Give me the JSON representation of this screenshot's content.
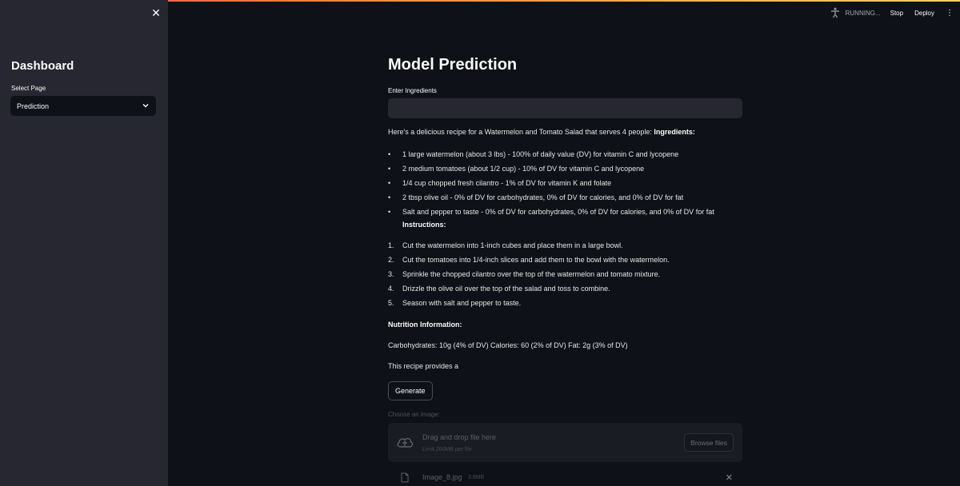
{
  "sidebar": {
    "close_icon": "close-icon",
    "title": "Dashboard",
    "select_label": "Select Page",
    "select_value": "Prediction"
  },
  "header": {
    "status": "RUNNING...",
    "stop": "Stop",
    "deploy": "Deploy",
    "menu": "⋮"
  },
  "main": {
    "title": "Model Prediction",
    "input_label": "Enter Ingredients",
    "input_value": "",
    "intro_text": "Here's a delicious recipe for a Watermelon and Tomato Salad that serves 4 people: ",
    "ingredients_heading": "Ingredients:",
    "ingredients": [
      "1 large watermelon (about 3 lbs) - 100% of daily value (DV) for vitamin C and lycopene",
      "2 medium tomatoes (about 1/2 cup) - 10% of DV for vitamin C and lycopene",
      "1/4 cup chopped fresh cilantro - 1% of DV for vitamin K and folate",
      "2 tbsp olive oil - 0% of DV for carbohydrates, 0% of DV for calories, and 0% of DV for fat",
      "Salt and pepper to taste - 0% of DV for carbohydrates, 0% of DV for calories, and 0% of DV for fat"
    ],
    "instructions_heading": "Instructions:",
    "instructions": [
      "Cut the watermelon into 1-inch cubes and place them in a large bowl.",
      "Cut the tomatoes into 1/4-inch slices and add them to the bowl with the watermelon.",
      "Sprinkle the chopped cilantro over the top of the watermelon and tomato mixture.",
      "Drizzle the olive oil over the top of the salad and toss to combine.",
      "Season with salt and pepper to taste."
    ],
    "nutrition_heading": "Nutrition Information:",
    "nutrition_text": "Carbohydrates: 10g (4% of DV) Calories: 60 (2% of DV) Fat: 2g (3% of DV)",
    "closing_text": "This recipe provides a",
    "generate_label": "Generate",
    "file_label": "Choose an image:",
    "dropzone_text": "Drag and drop file here",
    "dropzone_limit": "Limit 200MB per file",
    "browse_label": "Browse files",
    "file_name": "Image_8.jpg",
    "file_size": "3.8MB"
  },
  "colors": {
    "background": "#0e1117",
    "sidebar": "#262730",
    "accent": "#ff4b4b"
  }
}
